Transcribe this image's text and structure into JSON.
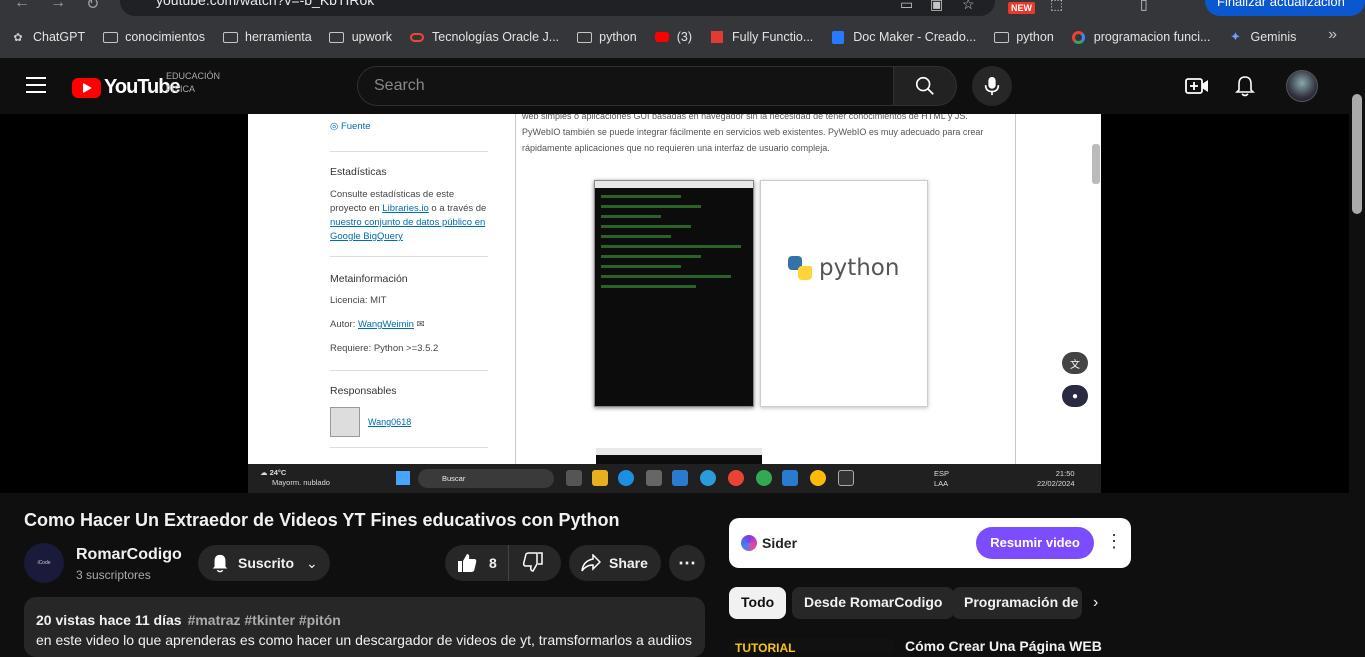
{
  "browser": {
    "url": "youtube.com/watch?v=-b_KbTIRok",
    "new_badge": "NEW",
    "update_button": "Finalizar actualización",
    "bookmarks": [
      {
        "label": "ChatGPT",
        "icon": "chatgpt-icon"
      },
      {
        "label": "conocimientos",
        "icon": "folder-icon"
      },
      {
        "label": "herramienta",
        "icon": "folder-icon"
      },
      {
        "label": "upwork",
        "icon": "folder-icon"
      },
      {
        "label": "Tecnologías Oracle J...",
        "icon": "oracle-icon"
      },
      {
        "label": "python",
        "icon": "folder-icon"
      },
      {
        "label": "(3)",
        "icon": "youtube-icon"
      },
      {
        "label": "Fully Functio...",
        "icon": "red-square-icon"
      },
      {
        "label": "Doc Maker - Creado...",
        "icon": "doc-icon"
      },
      {
        "label": "python",
        "icon": "folder-icon"
      },
      {
        "label": "programacion funci...",
        "icon": "google-icon"
      },
      {
        "label": "Geminis",
        "icon": "gemini-icon"
      }
    ],
    "more": "»"
  },
  "header": {
    "logo_text": "YouTube",
    "logo_sub_1": "EDUCACIÓN",
    "logo_sub_2": "FÍSICA",
    "search_placeholder": "Search"
  },
  "video_frame": {
    "sidebar": {
      "source_link": "Fuente",
      "stats_heading": "Estadísticas",
      "stats_text_1": "Consulte estadísticas de este proyecto en ",
      "stats_link_1": "Libraries.io",
      "stats_text_2": " o a través de ",
      "stats_link_2": "nuestro conjunto de datos público en Google BigQuery",
      "meta_heading": "Metainformación",
      "license": "Licencia: MIT",
      "author_label": "Autor: ",
      "author_link": "WangWeimin",
      "requires": "Requiere: Python >=3.5.2",
      "maintainers_heading": "Responsables",
      "maintainer": "Wang0618"
    },
    "body_text": "web simples o aplicaciones GUI basadas en navegador sin la necesidad de tener conocimientos de HTML y JS. PyWebIO también se puede integrar fácilmente en servicios web existentes. PyWebIO es muy adecuado para crear rápidamente aplicaciones que no requieren una interfaz de usuario compleja.",
    "python_logo_text": "python",
    "taskbar": {
      "temp": "24°C",
      "weather": "Mayorm. nublado",
      "search": "Buscar",
      "lang_1": "ESP",
      "lang_2": "LAA",
      "time": "21:50",
      "date": "22/02/2024"
    }
  },
  "video": {
    "title": "Como Hacer Un Extraedor de Videos YT Fines educativos con Python",
    "channel_name": "RomarCodigo",
    "subscribers": "3 suscriptores",
    "subscribe_label": "Suscrito",
    "likes": "8",
    "share_label": "Share",
    "meta": "20 vistas hace 11 días",
    "tags": "#matraz #tkinter #pitón",
    "description": "en este video lo que aprenderas es como hacer un descargador de videos de yt, tramsformarlos a audiios"
  },
  "sider": {
    "label": "Sider",
    "button": "Resumir video"
  },
  "chips": [
    {
      "label": "Todo",
      "active": true
    },
    {
      "label": "Desde RomarCodigo",
      "active": false
    },
    {
      "label": "Programación de c",
      "active": false
    }
  ],
  "recommended": {
    "thumb_text": "TUTORIAL",
    "title": "Cómo Crear Una Página WEB"
  }
}
